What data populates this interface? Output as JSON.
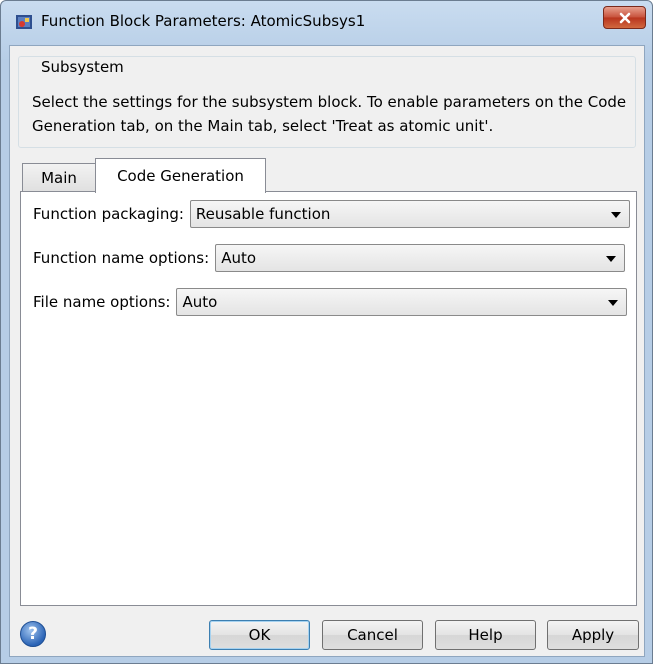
{
  "window": {
    "title": "Function Block Parameters: AtomicSubsys1"
  },
  "group": {
    "legend": "Subsystem",
    "description": "Select the settings for the subsystem block. To enable parameters on the Code Generation tab, on the Main tab, select 'Treat as atomic unit'."
  },
  "tabs": [
    {
      "label": "Main",
      "active": false
    },
    {
      "label": "Code Generation",
      "active": true
    }
  ],
  "fields": [
    {
      "label": "Function packaging:",
      "value": "Reusable function"
    },
    {
      "label": "Function name options:",
      "value": "Auto"
    },
    {
      "label": "File name options:",
      "value": "Auto"
    }
  ],
  "buttons": {
    "ok": "OK",
    "cancel": "Cancel",
    "help": "Help",
    "apply": "Apply"
  },
  "icons": {
    "help": "?"
  }
}
